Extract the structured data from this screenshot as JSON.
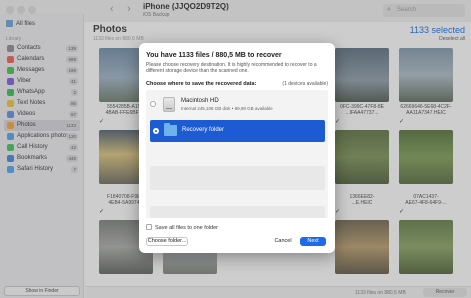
{
  "window": {
    "device_title": "iPhone (JJQO2D9T2Q)",
    "device_subtitle": "iOS Backup",
    "search_placeholder": "Search"
  },
  "sidebar": {
    "top_item": "All files",
    "section_label": "Library",
    "items": [
      {
        "label": "Contacts",
        "count": "139",
        "color": "#8a8a8a"
      },
      {
        "label": "Calendars",
        "count": "669",
        "color": "#e85a4f"
      },
      {
        "label": "Messages",
        "count": "199",
        "color": "#3ec34a"
      },
      {
        "label": "Viber",
        "count": "41",
        "color": "#7b5bd6"
      },
      {
        "label": "WhatsApp",
        "count": "2",
        "color": "#2fbe4d"
      },
      {
        "label": "Text Notes",
        "count": "86",
        "color": "#e8c23a"
      },
      {
        "label": "Videos",
        "count": "57",
        "color": "#5a8ee0"
      },
      {
        "label": "Photos",
        "count": "1133",
        "color": "#f0a23a"
      },
      {
        "label": "Applications photos",
        "count": "120",
        "color": "#4fa0e8"
      },
      {
        "label": "Call History",
        "count": "42",
        "color": "#3fbf5a"
      },
      {
        "label": "Bookmarks",
        "count": "445",
        "color": "#3f84e0"
      },
      {
        "label": "Safari History",
        "count": "7",
        "color": "#4fa0e8"
      }
    ],
    "show_in_finder": "Show in Finder"
  },
  "main": {
    "title": "Photos",
    "subtitle": "1133 files on 880,5 MB",
    "selected": "1133 selected",
    "deselect_all": "Deselect all",
    "row1_labels": [
      {
        "l1": "5554285B-A152-",
        "l2": "4BAB-FFE6BFD..."
      },
      {
        "l1": "",
        "l2": ""
      },
      {
        "l1": "0FC-399C-47F8-8E",
        "l2": "...IFAA47737..."
      },
      {
        "l1": "62669646-5E68-4C2F-",
        "l2": "AA11A7347.HEIC"
      }
    ],
    "row2_labels": [
      {
        "l1": "F1840708-F9E9-",
        "l2": "4EB4-5A9974..."
      },
      {
        "l1": "",
        "l2": ""
      },
      {
        "l1": "1366EE82-",
        "l2": "...E.HEIC"
      },
      {
        "l1": "07AC1437-",
        "l2": "AE67-4F8-64F9-..."
      }
    ],
    "bottom_status": "1133 files on 880,5 MB",
    "recover_button": "Recover"
  },
  "dialog": {
    "title": "You have 1133 files / 880,5 MB to recover",
    "description": "Please choose recovery destination. It is highly recommended to recover to a different storage device than the scanned one.",
    "choose_label": "Choose where to save the recovered data:",
    "available": "(1 devices available)",
    "mac_name": "Macintosh HD",
    "mac_details": "Internal 245,108 GB disk • 89,98 GB available",
    "recovery_folder": "Recovery folder",
    "save_one_folder": "Save all files to one folder",
    "choose_folder_button": "Choose folder...",
    "cancel_button": "Cancel",
    "next_button": "Next"
  },
  "colors": {
    "accent": "#1f6ae6",
    "selection": "#1c5bd2"
  }
}
